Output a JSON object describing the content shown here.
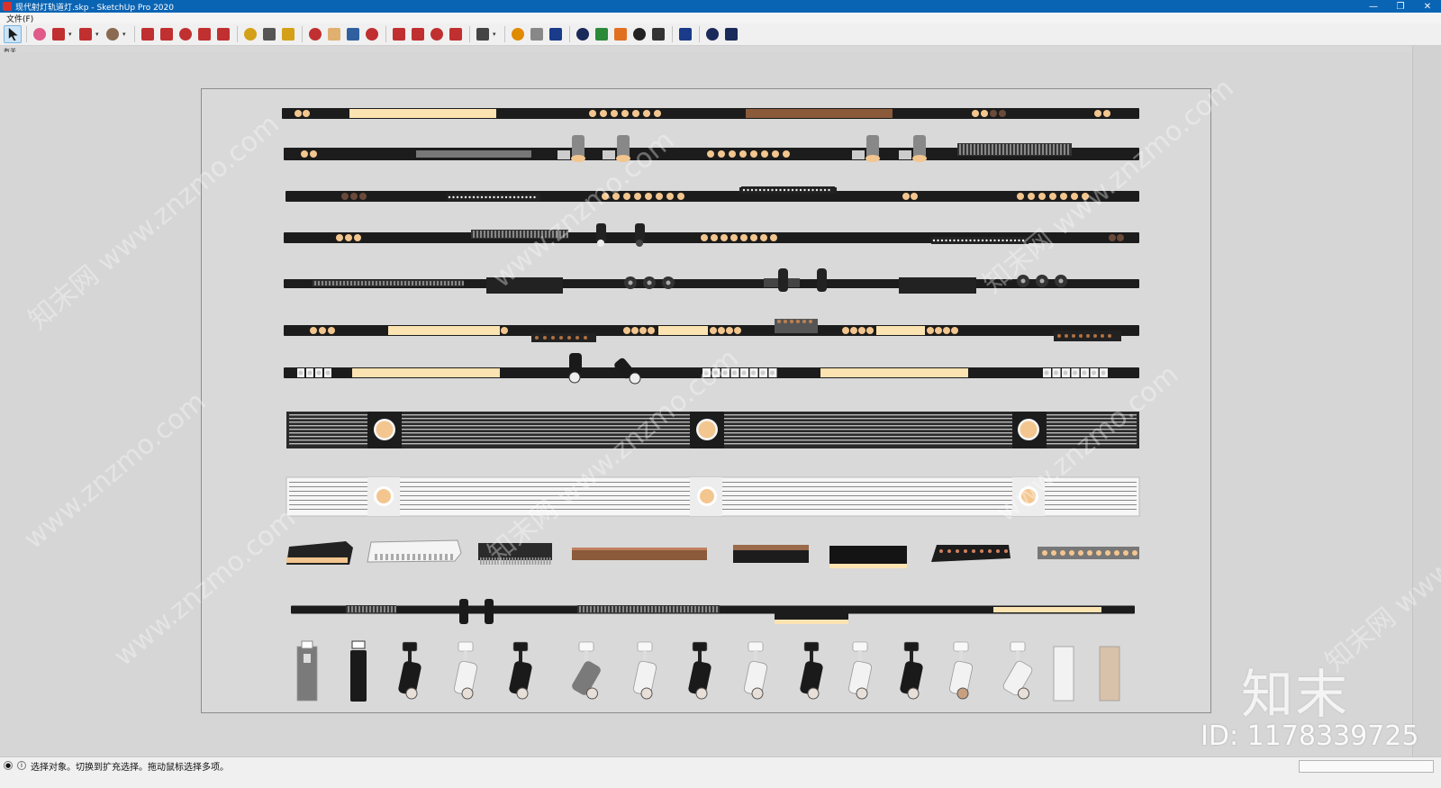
{
  "window": {
    "title": "现代射灯轨道灯.skp - SketchUp Pro 2020",
    "controls": [
      "minimize",
      "restore",
      "close"
    ],
    "control_glyphs": [
      "—",
      "❐",
      "✕"
    ]
  },
  "menu": {
    "items": [
      "文件(F)"
    ]
  },
  "tray_label": "有关",
  "toolbar": {
    "tools": [
      {
        "name": "select-tool",
        "icon": "cursor-arrow-icon",
        "color": "#1a1a1a",
        "active": true
      },
      {
        "name": "eraser-tool",
        "icon": "eraser-icon",
        "color": "#e05a8a"
      },
      {
        "name": "line-tool",
        "icon": "pencil-icon",
        "color": "#c03030",
        "dropdown": true
      },
      {
        "name": "arc-tool",
        "icon": "arc-icon",
        "color": "#c03030",
        "dropdown": true
      },
      {
        "name": "shape-tool",
        "icon": "circle-shape-icon",
        "color": "#8a6a50",
        "dropdown": true
      },
      {
        "name": "push-pull-tool",
        "icon": "push-pull-icon",
        "color": "#c03030"
      },
      {
        "name": "offset-tool",
        "icon": "offset-icon",
        "color": "#c03030"
      },
      {
        "name": "move-tool",
        "icon": "move-icon",
        "color": "#c03030"
      },
      {
        "name": "rotate-tool",
        "icon": "rotate-icon",
        "color": "#c03030"
      },
      {
        "name": "scale-tool",
        "icon": "scale-icon",
        "color": "#c03030"
      },
      {
        "name": "tape-measure-tool",
        "icon": "tape-measure-icon",
        "color": "#d4a017"
      },
      {
        "name": "text-tool",
        "icon": "text-icon",
        "color": "#555555"
      },
      {
        "name": "paint-bucket-tool",
        "icon": "paint-bucket-icon",
        "color": "#d4a017"
      },
      {
        "name": "orbit-tool",
        "icon": "orbit-icon",
        "color": "#c03030"
      },
      {
        "name": "pan-tool",
        "icon": "hand-icon",
        "color": "#e0b070"
      },
      {
        "name": "zoom-tool",
        "icon": "magnifier-icon",
        "color": "#3060a0"
      },
      {
        "name": "zoom-extents-tool",
        "icon": "zoom-extents-icon",
        "color": "#c03030"
      },
      {
        "name": "warehouse-tool",
        "icon": "3d-warehouse-icon",
        "color": "#c03030"
      },
      {
        "name": "share-model-tool",
        "icon": "share-model-icon",
        "color": "#c03030"
      },
      {
        "name": "extension-warehouse-tool",
        "icon": "extension-warehouse-icon",
        "color": "#c03030"
      },
      {
        "name": "ruby-tool",
        "icon": "ruby-icon",
        "color": "#c03030"
      },
      {
        "name": "account-tool",
        "icon": "user-account-icon",
        "color": "#444444",
        "dropdown": true
      },
      {
        "name": "plugin-tool-1",
        "icon": "plugin-orange-icon",
        "color": "#e08a00"
      },
      {
        "name": "plugin-tool-2",
        "icon": "refresh-icon",
        "color": "#888888"
      },
      {
        "name": "plugin-tool-3",
        "icon": "layers-icon",
        "color": "#1a3a8a"
      },
      {
        "name": "plugin-tool-4",
        "icon": "add-circle-icon",
        "color": "#1a2a5a"
      },
      {
        "name": "plugin-tool-5",
        "icon": "tree-icon",
        "color": "#2a8a3a"
      },
      {
        "name": "plugin-tool-6",
        "icon": "landscape-icon",
        "color": "#e07020"
      },
      {
        "name": "plugin-tool-7",
        "icon": "checker-icon",
        "color": "#222222"
      },
      {
        "name": "plugin-tool-8",
        "icon": "cloud-upload-icon",
        "color": "#333333"
      },
      {
        "name": "settings-tool",
        "icon": "gear-icon",
        "color": "#1a3a8a"
      },
      {
        "name": "mail-tool",
        "icon": "envelope-icon",
        "color": "#1a2a5a"
      },
      {
        "name": "info-tool",
        "icon": "info-icon",
        "color": "#1a2a5a"
      }
    ]
  },
  "status": {
    "text": "选择对象。切换到扩充选择。拖动鼠标选择多项。"
  },
  "watermark": {
    "site": "www.znzmo.com",
    "brand": "知末网",
    "logo_text": "知末",
    "id_text": "ID: 1178339725"
  },
  "colors": {
    "track_black": "#1c1c1c",
    "light_warm": "#f3c68f",
    "light_cream": "#fbe3b2",
    "copper": "#8a5a3a",
    "white_fixture": "#f2f2f2",
    "gray_fixture": "#7a7a7a"
  },
  "model": {
    "tracks": [
      {
        "kind": "dot-line",
        "parts": [
          "dots:2",
          "strip",
          "dots:7",
          "copper-strip",
          "dots:4",
          "dots:2"
        ]
      },
      {
        "kind": "spot-track",
        "parts": [
          "dots:2",
          "gray-strip",
          "spot",
          "spot",
          "dots:8",
          "spot",
          "spot",
          "grille"
        ]
      },
      {
        "kind": "dot-line",
        "parts": [
          "dots:3",
          "micro-dots",
          "dots:8",
          "grille",
          "dots:2",
          "dots:8"
        ]
      },
      {
        "kind": "spot-track",
        "parts": [
          "dots:3",
          "grille",
          "spot-small",
          "spot-small",
          "dots:8",
          "micro-dots",
          "dots:2"
        ]
      },
      {
        "kind": "mixed",
        "parts": [
          "long-grille",
          "block",
          "rings:3",
          "spot-small",
          "spot-small",
          "block",
          "rings:3"
        ]
      },
      {
        "kind": "mixed",
        "parts": [
          "dots:3",
          "strip",
          "block",
          "dots:4",
          "strip",
          "dots:4",
          "grille",
          "dots:4",
          "strip",
          "dots:4",
          "block"
        ]
      },
      {
        "kind": "white-dots",
        "parts": [
          "wdots:4",
          "strip",
          "spot-black",
          "spot-black",
          "wdots:8",
          "strip",
          "wdots:7"
        ]
      }
    ],
    "linear_panels": [
      {
        "kind": "dark-slat",
        "downlights": 3
      },
      {
        "kind": "white-slat",
        "downlights": 3
      }
    ],
    "modules": [
      "angled-black-wall-washer",
      "white-grille-module",
      "black-comb-module",
      "copper-flat-strip",
      "copper-edge-box",
      "black-box-module",
      "black-dot-module",
      "gray-dot-module"
    ],
    "final_track": [
      "grille-strip",
      "spot",
      "spot",
      "grille-strip",
      "block",
      "strip"
    ],
    "spotlights": [
      {
        "style": "gray-cylinder"
      },
      {
        "style": "black-pendant"
      },
      {
        "style": "black-tilt"
      },
      {
        "style": "white-tilt"
      },
      {
        "style": "black-tilt"
      },
      {
        "style": "gray-angled"
      },
      {
        "style": "white-tilt"
      },
      {
        "style": "black-dome"
      },
      {
        "style": "white-tilt"
      },
      {
        "style": "black-tilt"
      },
      {
        "style": "white-tilt"
      },
      {
        "style": "black-tilt"
      },
      {
        "style": "white-bronze"
      },
      {
        "style": "white-angled"
      },
      {
        "style": "white-cylinder"
      },
      {
        "style": "beige-cylinder"
      }
    ]
  }
}
